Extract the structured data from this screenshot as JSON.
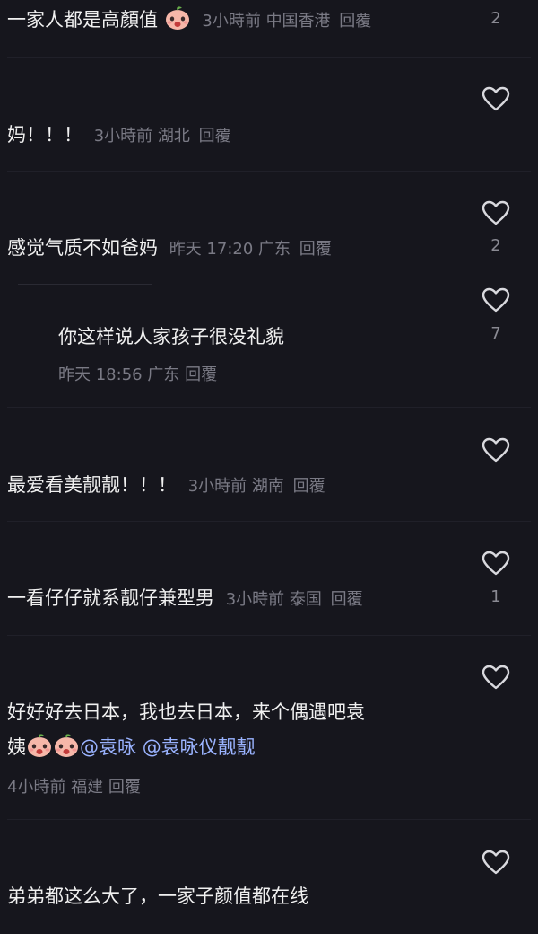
{
  "comments": [
    {
      "text": "一家人都是高顏值",
      "time": "3小時前",
      "location": "中国香港",
      "reply": "回覆",
      "likes": "2"
    },
    {
      "text": "妈！！！",
      "time": "3小時前",
      "location": "湖北",
      "reply": "回覆",
      "likes": ""
    },
    {
      "text": "感觉气质不如爸妈",
      "time": "昨天 17:20",
      "location": "广东",
      "reply": "回覆",
      "likes": "2"
    },
    {
      "text": "你这样说人家孩子很没礼貌",
      "time": "昨天 18:56",
      "location": "广东",
      "reply": "回覆",
      "likes": "7"
    },
    {
      "text": "最爱看美靓靓！！！",
      "time": "3小時前",
      "location": "湖南",
      "reply": "回覆",
      "likes": ""
    },
    {
      "text": "一看仔仔就系靓仔兼型男",
      "time": "3小時前",
      "location": "泰国",
      "reply": "回覆",
      "likes": "1"
    },
    {
      "text_line1": "好好好去日本，我也去日本，来个偶遇吧袁",
      "text_line2": "姨",
      "mention1": "@袁咏",
      "mention2": "@袁咏仪靓靓",
      "time": "4小時前",
      "location": "福建",
      "reply": "回覆",
      "likes": ""
    },
    {
      "text": "弟弟都这么大了，一家子颜值都在线",
      "likes": ""
    }
  ],
  "icons": {
    "like": "heart-outline-icon",
    "emoji": "peach-face-emoji"
  },
  "colors": {
    "background": "#16161d",
    "meta": "#7a7a85",
    "mention": "#9ab3ff"
  }
}
